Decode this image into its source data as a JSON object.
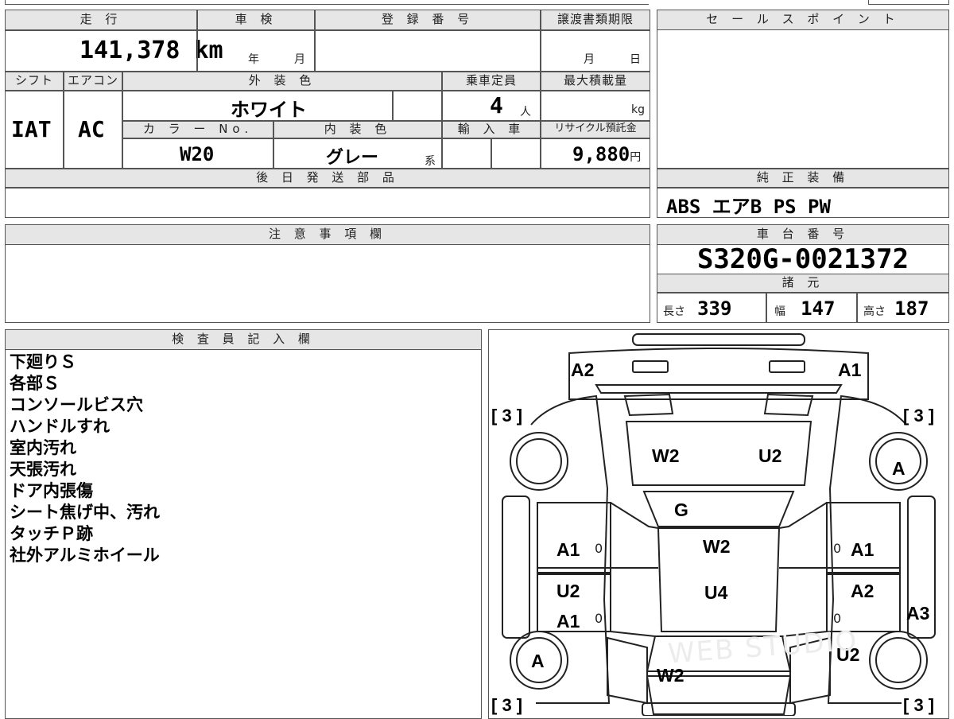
{
  "top": {
    "mileage_label": "走 行",
    "mileage_value": "141,378",
    "mileage_unit": "km",
    "inspection_label": "車 検",
    "inspection_year": "年",
    "inspection_month": "月",
    "registration_label": "登 録 番 号",
    "transfer_label": "譲渡書類期限",
    "transfer_month": "月",
    "transfer_day": "日"
  },
  "spec": {
    "shift_label": "シフト",
    "shift_value": "IAT",
    "ac_label": "エアコン",
    "ac_value": "AC",
    "exterior_label": "外 装 色",
    "exterior_value": "ホワイト",
    "capacity_label": "乗車定員",
    "capacity_value": "4",
    "capacity_unit": "人",
    "load_label": "最大積載量",
    "load_unit": "kg",
    "color_no_label": "カ ラ ー No.",
    "color_no_value": "W20",
    "interior_label": "内 装 色",
    "interior_value": "グレー",
    "interior_unit": "系",
    "import_label": "輸 入 車",
    "recycle_label": "リサイクル預託金",
    "recycle_value": "9,880",
    "recycle_unit": "円"
  },
  "later_parts_label": "後 日 発 送 部 品",
  "sales_point_label": "セ ー ル ス ポ イ ン ト",
  "equipment_label": "純 正 装 備",
  "equipment_value": "ABS エアB PS PW",
  "notes_label": "注 意 事 項 欄",
  "chassis_label": "車 台 番 号",
  "chassis_value": "S320G-0021372",
  "dimensions_label": "諸 元",
  "dimensions": {
    "length_label": "長さ",
    "length_value": "339",
    "width_label": "幅",
    "width_value": "147",
    "height_label": "高さ",
    "height_value": "187"
  },
  "inspector_label": "検 査 員 記 入 欄",
  "inspector_notes": [
    "下廻りＳ",
    "各部Ｓ",
    "コンソールビス穴",
    "ハンドルすれ",
    "室内汚れ",
    "天張汚れ",
    "ドア内張傷",
    "シート焦げ中、汚れ",
    "タッチＰ跡",
    "社外アルミホイール"
  ],
  "diagram": {
    "bracket_tl": "[ 3 ]",
    "bracket_tr": "[ 3 ]",
    "bracket_bl": "[ 3 ]",
    "bracket_br": "[ 3 ]",
    "a2_front": "A2",
    "a1_front": "A1",
    "hood_w2": "W2",
    "hood_u2": "U2",
    "wheel_fr": "A",
    "wheel_rl": "A",
    "cowl_g": "G",
    "roof_w2": "W2",
    "roof_u4": "U4",
    "door_l1_a1": "A1",
    "door_l2_u2": "U2",
    "door_l2_a1": "A1",
    "door_r1_a1": "A1",
    "door_r2_a2": "A2",
    "rear_r_a3": "A3",
    "rear_r_u2": "U2",
    "rear_w2": "W2",
    "zero1": "0",
    "zero2": "0",
    "zero3": "0",
    "zero4": "0",
    "watermark": "WEB STUDIO"
  }
}
